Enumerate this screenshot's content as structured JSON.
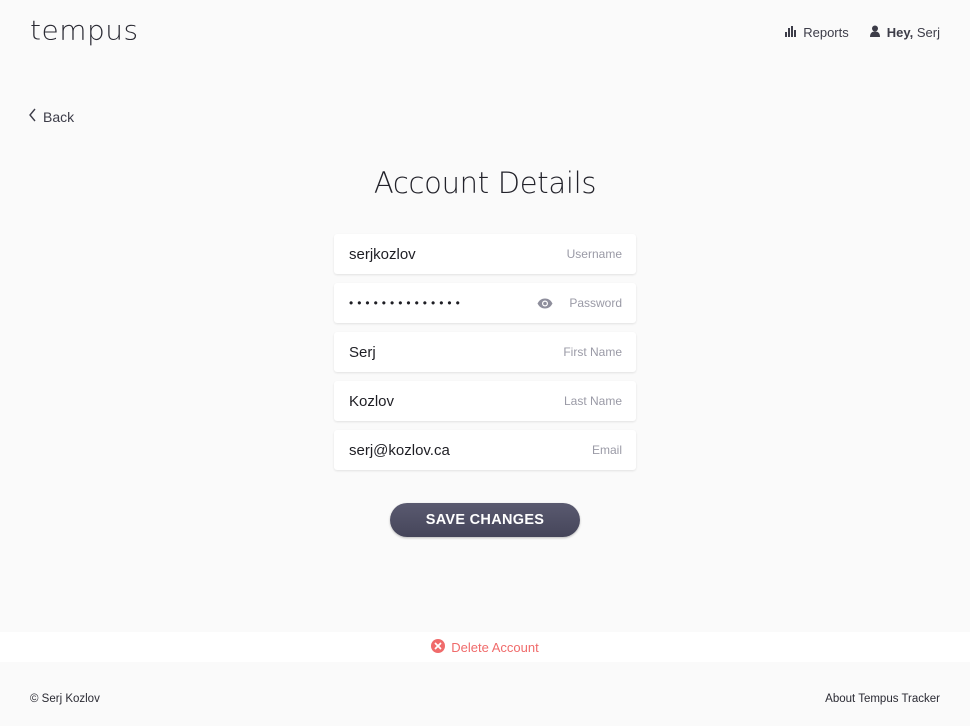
{
  "header": {
    "logo": "tempus",
    "nav": {
      "reports_label": "Reports",
      "reports_icon": "bar-chart-icon",
      "greeting_prefix": "Hey,",
      "user_name": "Serj",
      "user_icon": "user-icon"
    }
  },
  "back": {
    "label": "Back",
    "icon": "chevron-left-icon"
  },
  "page": {
    "title": "Account Details"
  },
  "form": {
    "fields": [
      {
        "value": "serjkozlov",
        "label": "Username"
      },
      {
        "value": "••••••••••••••",
        "label": "Password",
        "icon": "eye-icon"
      },
      {
        "value": "Serj",
        "label": "First Name"
      },
      {
        "value": "Kozlov",
        "label": "Last Name"
      },
      {
        "value": "serj@kozlov.ca",
        "label": "Email"
      }
    ],
    "save_label": "SAVE CHANGES"
  },
  "danger": {
    "delete_label": "Delete Account",
    "delete_icon": "close-circle-icon",
    "color": "#f06b6b"
  },
  "footer": {
    "copyright": "© Serj Kozlov",
    "about_link": "About Tempus Tracker"
  },
  "colors": {
    "background": "#fafafa",
    "button": "#4e4e63",
    "delete": "#f06b6b",
    "label": "#9a9aa6"
  }
}
